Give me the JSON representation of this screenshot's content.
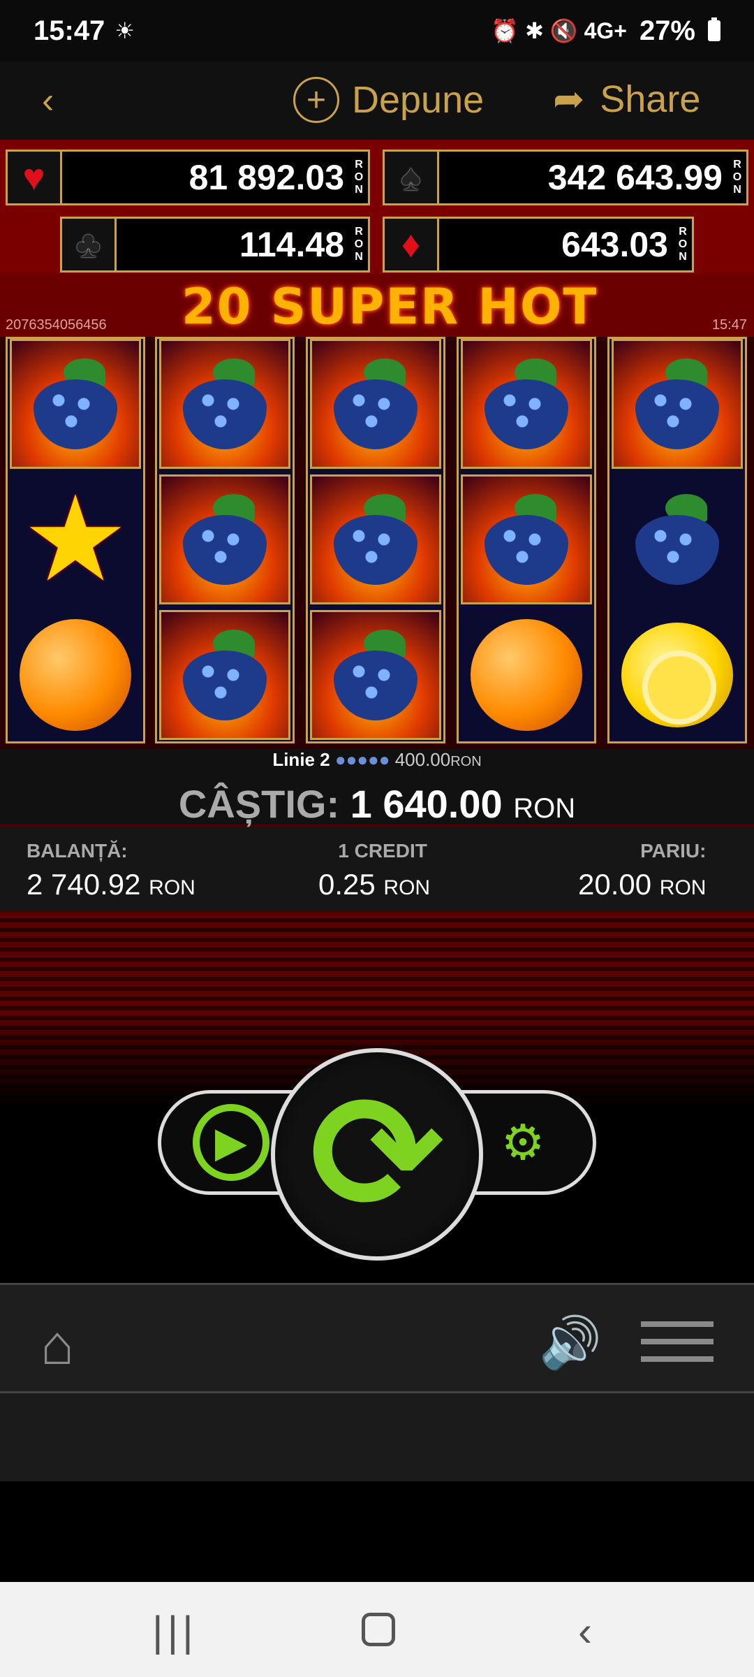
{
  "status_bar": {
    "time": "15:47",
    "weather_icon": "sunrise-icon",
    "right_icons": "⏰ ✱ 🔇 4G+ ",
    "battery": "27%"
  },
  "nav": {
    "back": "‹",
    "deposit_label": "Depune",
    "share_label": "Share"
  },
  "jackpots": {
    "hearts": {
      "icon": "♥",
      "value": "81 892.03"
    },
    "spades": {
      "icon": "♠",
      "value": "342 643.99"
    },
    "clubs": {
      "icon": "♣",
      "value": "114.48"
    },
    "diamonds": {
      "icon": "♦",
      "value": "643.03"
    },
    "currency_vertical": "R O N"
  },
  "game": {
    "title": "20 SUPER HOT",
    "ticket_id": "2076354056456",
    "time": "15:47"
  },
  "reels": [
    [
      "grape",
      "star",
      "orange"
    ],
    [
      "grape",
      "grape",
      "grape"
    ],
    [
      "grape",
      "grape",
      "grape"
    ],
    [
      "grape",
      "grape",
      "orange"
    ],
    [
      "grape",
      "grape",
      "lemon"
    ]
  ],
  "win_line": {
    "line": "Linie 2",
    "amount": "400.00",
    "currency": "RON"
  },
  "win": {
    "label": "CÂȘTIG:",
    "amount": "1 640.00",
    "currency": "RON"
  },
  "info": {
    "balance": {
      "label": "BALANȚĂ:",
      "value": "2 740.92",
      "currency": "RON"
    },
    "credit": {
      "label": "1 CREDIT",
      "value": "0.25",
      "currency": "RON"
    },
    "bet": {
      "label": "PARIU:",
      "value": "20.00",
      "currency": "RON"
    }
  },
  "controls": {
    "autoplay_icon": "▶",
    "spin_icon": "⟳",
    "settings_icon": "⚙"
  },
  "toolbar": {
    "home_icon": "⌂",
    "sound_icon": "🔊"
  },
  "system_nav": {
    "recents": "|||",
    "back": "‹"
  }
}
